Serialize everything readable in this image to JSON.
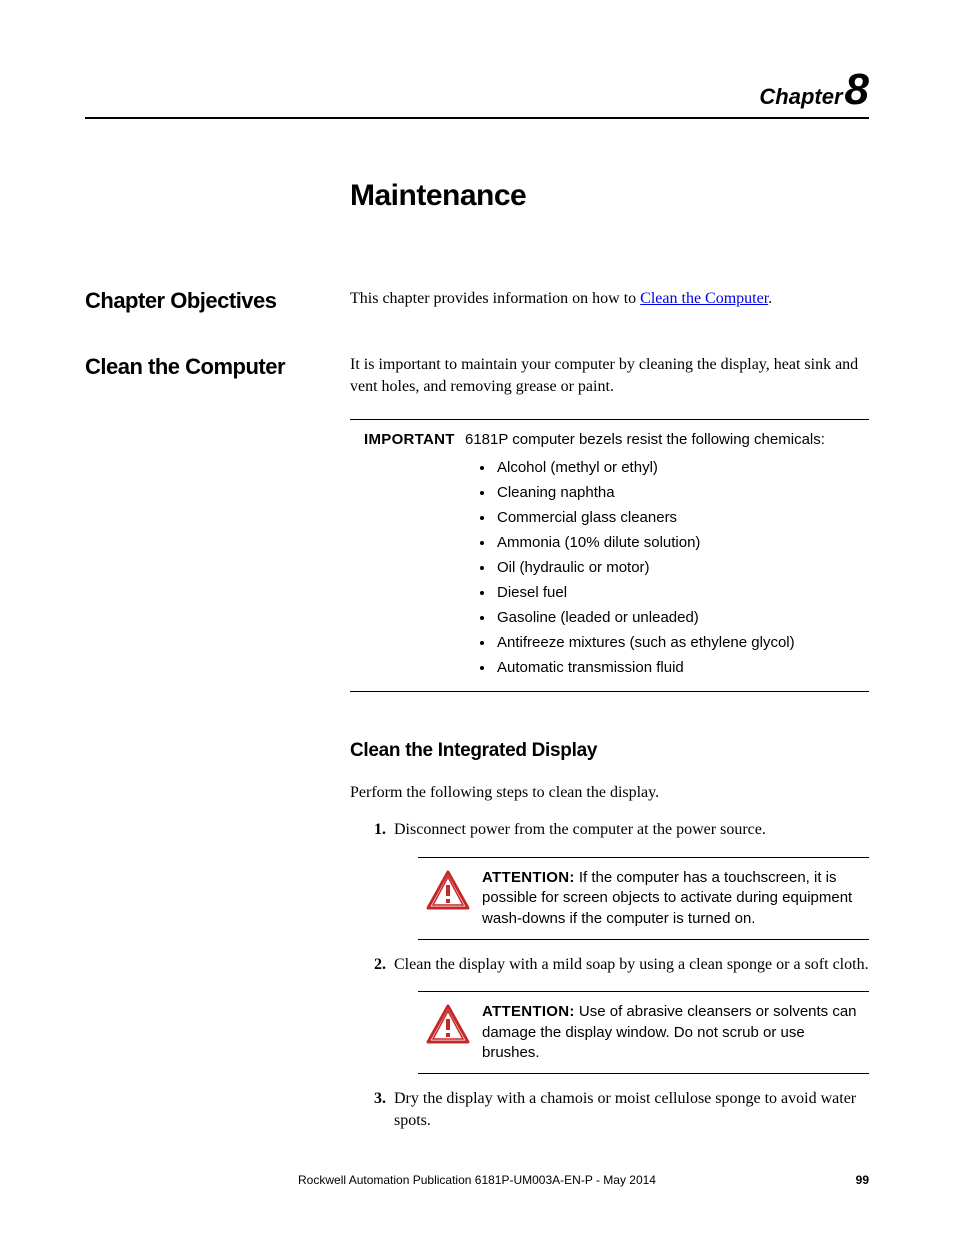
{
  "chapter": {
    "label": "Chapter",
    "number": "8"
  },
  "page_title": "Maintenance",
  "sections": {
    "objectives": {
      "heading": "Chapter Objectives",
      "intro_prefix": "This chapter provides information on how to ",
      "link_text": "Clean the Computer",
      "intro_suffix": "."
    },
    "clean": {
      "heading": "Clean the Computer",
      "intro": "It is important to maintain your computer by cleaning the display, heat sink and vent holes, and removing grease or paint.",
      "important": {
        "label": "IMPORTANT",
        "lead": "6181P computer bezels resist the following chemicals:",
        "items": [
          "Alcohol (methyl or ethyl)",
          "Cleaning naphtha",
          "Commercial glass cleaners",
          "Ammonia (10% dilute solution)",
          "Oil (hydraulic or motor)",
          "Diesel fuel",
          "Gasoline (leaded or unleaded)",
          "Antifreeze mixtures (such as ethylene glycol)",
          "Automatic transmission fluid"
        ]
      },
      "subheading": "Clean the Integrated Display",
      "sub_intro": "Perform the following steps to clean the display.",
      "steps": {
        "s1": "Disconnect power from the computer at the power source.",
        "s2": "Clean the display with a mild soap by using a clean sponge or a soft cloth.",
        "s3": "Dry the display with a chamois or moist cellulose sponge to avoid water spots."
      },
      "attention1": {
        "label": "ATTENTION:",
        "text": " If the computer has a touchscreen, it is possible for screen objects to activate during equipment wash-downs if the computer is turned on."
      },
      "attention2": {
        "label": "ATTENTION:",
        "text": " Use of abrasive cleansers or solvents can damage the display window. Do not scrub or use brushes."
      }
    }
  },
  "footer": {
    "publication": "Rockwell Automation Publication 6181P-UM003A-EN-P - May 2014",
    "page_number": "99"
  }
}
